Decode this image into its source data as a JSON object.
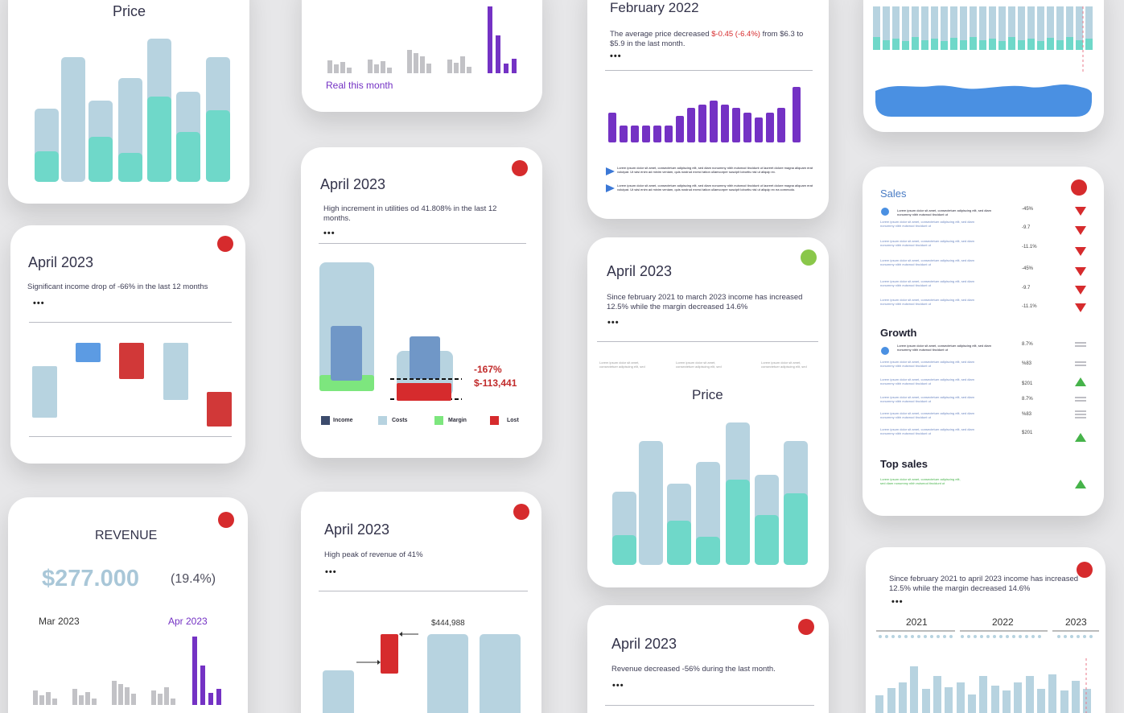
{
  "colors": {
    "accent_purple": "#7432c4",
    "bar_light": "#b7d3e0",
    "bar_teal": "#6fd8c9",
    "bar_blue": "#7097c7",
    "alert_red": "#d62b2d",
    "good_green": "#8ac74a",
    "area_blue": "#4a90e2",
    "bar_grey": "#c2c2c6"
  },
  "price_card_top": {
    "title": "Price"
  },
  "real_card": {
    "label": "Real this month"
  },
  "feb_card": {
    "title": "February 2022",
    "desc_pre": "The average price decreased ",
    "desc_highlight": "$-0.45 (-6.4%)",
    "desc_post": " from $6.3 to $5.9 in the last month.",
    "more": "•••",
    "note1": "Lorem ipsum dolor sit amet, consectetuer adipiscing elit, sed diam nonummy nibh euismod tincidunt ut laoreet dolore magna aliquam erat volutpat. Ut wisi enim ad minim veniam, quis nostrud exerci tation ullamcorper suscipit lobortis nisl ut aliquip ex.",
    "note2": "Lorem ipsum dolor sit amet, consectetuer adipiscing elit, sed diam nonummy nibh euismod tincidunt ut laoreet dolore magna aliquam erat volutpat. Ut wisi enim ad minim veniam, quis nostrud exerci tation ullamcorper suscipit lobortis nisl ut aliquip ex ea commodo."
  },
  "income_drop_card": {
    "title": "April 2023",
    "desc": "Significant income drop of -66% in the last 12 months",
    "more": "•••"
  },
  "utilities_card": {
    "title": "April 2023",
    "desc": "High increment in utilities od 41.808% in the last 12 months.",
    "more": "•••",
    "pct": "-167%",
    "amount": "$-113,441",
    "legend": [
      "Income",
      "Costs",
      "Margin",
      "Lost"
    ]
  },
  "income_growth_card": {
    "title": "April 2023",
    "desc": "Since february 2021 to march 2023 income has increased 12.5% while the margin decreased 14.6%",
    "more": "•••",
    "sub1": "Lorem ipsum dolor sit amet, consectetuer adipiscing elit, sed",
    "sub2": "Lorem ipsum dolor sit amet, consectetuer adipiscing elit, sed",
    "sub3": "Lorem ipsum dolor sit amet, consectetuer adipiscing elit, sed",
    "chart_title": "Price"
  },
  "revenue_card": {
    "title": "REVENUE",
    "amount": "$277.000",
    "change": "(19.4%)",
    "from": "Mar 2023",
    "to": "Apr 2023"
  },
  "peak_card": {
    "title": "April 2023",
    "desc": "High peak of revenue of 41%",
    "more": "•••",
    "value_label": "$444,988"
  },
  "revenue_decrease_card": {
    "title": "April 2023",
    "desc": "Revenue decreased -56% during the last month.",
    "more": "•••"
  },
  "list_card": {
    "sales_title": "Sales",
    "sales": [
      {
        "text": "Lorem ipsum dolor sit amet, consectetuer adipiscing elit, sed diam nonummy nibh euismod tincidunt ut",
        "value": "-45%"
      },
      {
        "text": "Lorem ipsum dolor sit amet, consectetuer adipiscing elit, sed diam nonummy nibh euismod tincidunt ut",
        "value": "-9.7"
      },
      {
        "text": "Lorem ipsum dolor sit amet, consectetuer adipiscing elit, sed diam nonummy nibh euismod tincidunt ut",
        "value": "-11.1%"
      },
      {
        "text": "Lorem ipsum dolor sit amet, consectetuer adipiscing elit, sed diam nonummy nibh euismod tincidunt ut",
        "value": "-45%"
      },
      {
        "text": "Lorem ipsum dolor sit amet, consectetuer adipiscing elit, sed diam nonummy nibh euismod tincidunt ut",
        "value": "-9.7"
      },
      {
        "text": "Lorem ipsum dolor sit amet, consectetuer adipiscing elit, sed diam nonummy nibh euismod tincidunt ut",
        "value": "-11.1%"
      }
    ],
    "growth_title": "Growth",
    "growth": [
      {
        "text": "Lorem ipsum dolor sit amet, consectetuer adipiscing elit, sed diam nonummy nibh euismod tincidunt ut",
        "value": "8.7%"
      },
      {
        "text": "Lorem ipsum dolor sit amet, consectetuer adipiscing elit, sed diam nonummy nibh euismod tincidunt ut",
        "value": "%83"
      },
      {
        "text": "Lorem ipsum dolor sit amet, consectetuer adipiscing elit, sed diam nonummy nibh euismod tincidunt ut",
        "value": "$201"
      },
      {
        "text": "Lorem ipsum dolor sit amet, consectetuer adipiscing elit, sed diam nonummy nibh euismod tincidunt ut",
        "value": "8.7%"
      },
      {
        "text": "Lorem ipsum dolor sit amet, consectetuer adipiscing elit, sed diam nonummy nibh euismod tincidunt ut",
        "value": "%83"
      },
      {
        "text": "Lorem ipsum dolor sit amet, consectetuer adipiscing elit, sed diam nonummy nibh euismod tincidunt ut",
        "value": "$201"
      }
    ],
    "top_title": "Top sales",
    "top_text": "Lorem ipsum dolor sit amet, consectetuer adipiscing elit, sed diam nonummy nibh euismod tincidunt ut"
  },
  "years_card": {
    "desc": "Since february 2021 to april 2023 income has increased 12.5% while the margin decreased 14.6%",
    "more": "•••",
    "years": [
      "2021",
      "2022",
      "2023"
    ]
  }
}
